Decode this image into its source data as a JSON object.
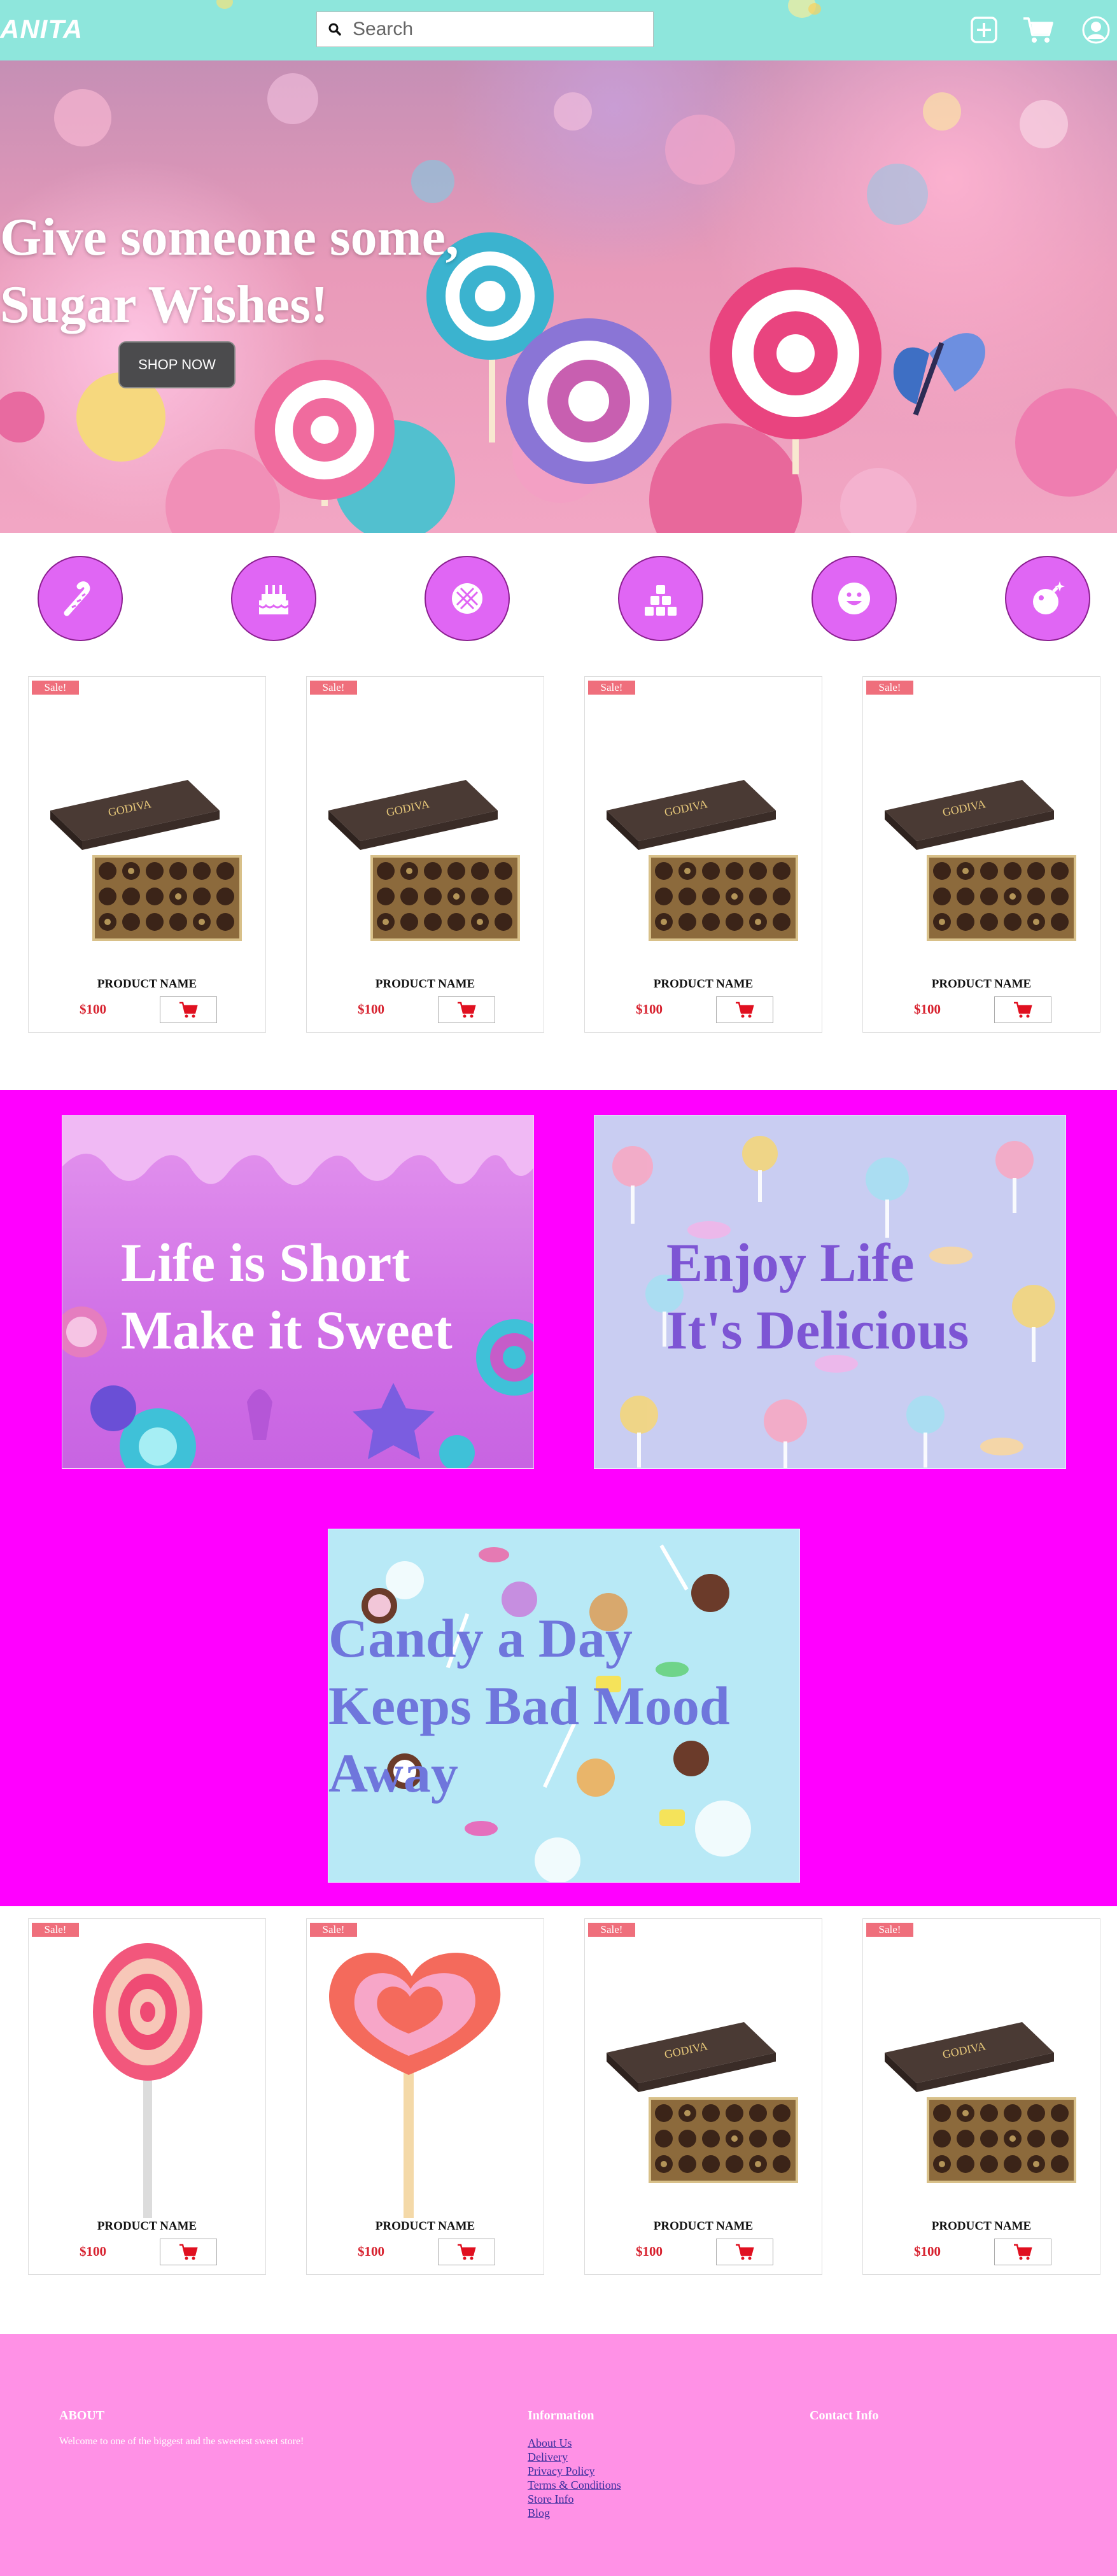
{
  "nav": {
    "logo": "ANITA",
    "search_placeholder": "Search",
    "icons": [
      "search-icon",
      "plus-icon",
      "cart-icon",
      "user-icon"
    ],
    "bar_color": "#8ee6dc"
  },
  "hero": {
    "title_line1": "Give someone some,",
    "title_line2": "Sugar Wishes!",
    "cta_label": "SHOP NOW"
  },
  "categories": [
    {
      "icon": "candy-cane-icon"
    },
    {
      "icon": "birthday-cake-icon"
    },
    {
      "icon": "cookie-icon"
    },
    {
      "icon": "sugar-cubes-icon"
    },
    {
      "icon": "smiley-candy-icon"
    },
    {
      "icon": "bomb-candy-icon"
    }
  ],
  "products_top": [
    {
      "badge": "Sale!",
      "name": "PRODUCT NAME",
      "price": "$100",
      "image": "chocolate-box"
    },
    {
      "badge": "Sale!",
      "name": "PRODUCT NAME",
      "price": "$100",
      "image": "chocolate-box"
    },
    {
      "badge": "Sale!",
      "name": "PRODUCT NAME",
      "price": "$100",
      "image": "chocolate-box"
    },
    {
      "badge": "Sale!",
      "name": "PRODUCT NAME",
      "price": "$100",
      "image": "chocolate-box"
    }
  ],
  "promo": {
    "background": "#ff00ff",
    "banner1": {
      "line1": "Life is Short",
      "line2": "Make it Sweet"
    },
    "banner2": {
      "line1": "Enjoy Life",
      "line2": "It's Delicious"
    },
    "banner3": {
      "line1": "Candy a Day",
      "line2": "Keeps Bad Mood",
      "line3": "Away"
    }
  },
  "products_bottom": [
    {
      "badge": "Sale!",
      "name": "PRODUCT NAME",
      "price": "$100",
      "image": "swirl-lollipop"
    },
    {
      "badge": "Sale!",
      "name": "PRODUCT NAME",
      "price": "$100",
      "image": "heart-lollipop"
    },
    {
      "badge": "Sale!",
      "name": "PRODUCT NAME",
      "price": "$100",
      "image": "chocolate-box"
    },
    {
      "badge": "Sale!",
      "name": "PRODUCT NAME",
      "price": "$100",
      "image": "chocolate-box"
    }
  ],
  "footer": {
    "about_heading": "ABOUT",
    "about_text": "Welcome to one of the biggest and the sweetest sweet store!",
    "info_heading": "Information",
    "links": [
      "About Us",
      "Delivery",
      "Privacy Policy",
      "Terms & Conditions",
      "Store Info",
      "Blog"
    ],
    "contact_heading": "Contact Info",
    "background": "#ff91e6"
  }
}
